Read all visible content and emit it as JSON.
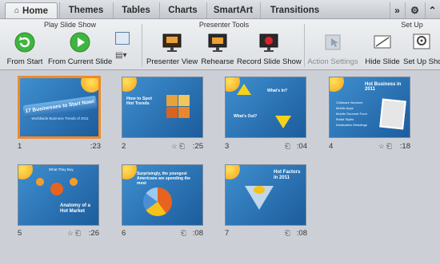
{
  "tabs": [
    {
      "label": "Home"
    },
    {
      "label": "Themes"
    },
    {
      "label": "Tables"
    },
    {
      "label": "Charts"
    },
    {
      "label": "SmartArt"
    },
    {
      "label": "Transitions"
    }
  ],
  "tabbar_right": {
    "overflow": "»",
    "settings": "⚙",
    "collapse": "⌃"
  },
  "groups": {
    "play": "Play Slide Show",
    "presenter": "Presenter Tools",
    "setup": "Set Up"
  },
  "buttons": {
    "from_start": "From Start",
    "from_current": "From Current Slide",
    "presenter_view": "Presenter View",
    "rehearse": "Rehearse",
    "record": "Record Slide Show",
    "action_settings": "Action Settings",
    "hide_slide": "Hide Slide",
    "setup_show": "Set Up Show"
  },
  "slides": [
    {
      "num": "1",
      "time": ":23",
      "icons": "",
      "title": "17 Businesses to Start Now!",
      "sub": "Worldwide Business Trends of 2011"
    },
    {
      "num": "2",
      "time": ":25",
      "icons": "☆ ⎗",
      "title": "How to Spot Hot Trends"
    },
    {
      "num": "3",
      "time": ":04",
      "icons": "⎗",
      "title": "What's In?",
      "sub": "What's Out?"
    },
    {
      "num": "4",
      "time": ":18",
      "icons": "☆ ⎗",
      "title": "Hot Business in 2011",
      "items": [
        "Childcare Services",
        "Mobile Apps",
        "Mobile Gourmet Food",
        "Bridal Stylist",
        "Destination Weddings"
      ]
    },
    {
      "num": "5",
      "time": ":26",
      "icons": "☆ ⎗",
      "title": "Anatomy of a Hot Market",
      "sub": "What They Buy"
    },
    {
      "num": "6",
      "time": ":08",
      "icons": "⎗",
      "title": "Surprisingly, the youngest Americans are spending the most"
    },
    {
      "num": "7",
      "time": ":08",
      "icons": "⎗",
      "title": "Hot Factors in 2011"
    }
  ]
}
